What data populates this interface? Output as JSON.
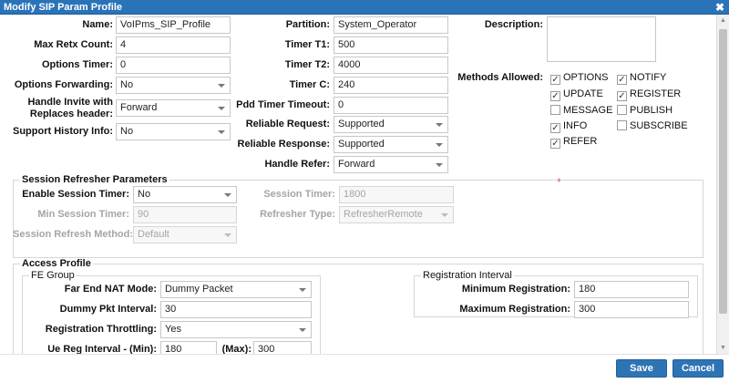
{
  "window": {
    "title": "Modify SIP Param Profile",
    "close_glyph": "✖"
  },
  "left": {
    "name_label": "Name:",
    "name_value": "VoIPms_SIP_Profile",
    "max_retx_label": "Max Retx Count:",
    "max_retx_value": "4",
    "options_timer_label": "Options Timer:",
    "options_timer_value": "0",
    "options_fwd_label": "Options Forwarding:",
    "options_fwd_value": "No",
    "handle_invite_label": "Handle Invite with Replaces header:",
    "handle_invite_value": "Forward",
    "support_history_label": "Support History Info:",
    "support_history_value": "No"
  },
  "middle": {
    "partition_label": "Partition:",
    "partition_value": "System_Operator",
    "t1_label": "Timer T1:",
    "t1_value": "500",
    "t2_label": "Timer T2:",
    "t2_value": "4000",
    "tc_label": "Timer C:",
    "tc_value": "240",
    "pdd_label": "Pdd Timer Timeout:",
    "pdd_value": "0",
    "rel_req_label": "Reliable Request:",
    "rel_req_value": "Supported",
    "rel_resp_label": "Reliable Response:",
    "rel_resp_value": "Supported",
    "handle_refer_label": "Handle Refer:",
    "handle_refer_value": "Forward"
  },
  "right": {
    "description_label": "Description:",
    "methods_label": "Methods Allowed:",
    "methods": [
      {
        "label": "OPTIONS",
        "checked": true
      },
      {
        "label": "NOTIFY",
        "checked": true
      },
      {
        "label": "UPDATE",
        "checked": true
      },
      {
        "label": "REGISTER",
        "checked": true
      },
      {
        "label": "MESSAGE",
        "checked": false
      },
      {
        "label": "PUBLISH",
        "checked": false
      },
      {
        "label": "INFO",
        "checked": true
      },
      {
        "label": "SUBSCRIBE",
        "checked": false
      },
      {
        "label": "REFER",
        "checked": true
      }
    ]
  },
  "session_refresher": {
    "legend": "Session Refresher Parameters",
    "enable_label": "Enable Session Timer:",
    "enable_value": "No",
    "session_timer_label": "Session Timer:",
    "session_timer_value": "1800",
    "min_session_label": "Min Session Timer:",
    "min_session_value": "90",
    "refresher_type_label": "Refresher Type:",
    "refresher_type_value": "RefresherRemote",
    "refresh_method_label": "Session Refresh Method:",
    "refresh_method_value": "Default"
  },
  "access_profile": {
    "legend": "Access Profile",
    "fe_group_legend": "FE Group",
    "nat_mode_label": "Far End NAT Mode:",
    "nat_mode_value": "Dummy Packet",
    "dummy_pkt_label": "Dummy Pkt Interval:",
    "dummy_pkt_value": "30",
    "reg_throttle_label": "Registration Throttling:",
    "reg_throttle_value": "Yes",
    "ue_reg_label": "Ue Reg Interval - (Min):",
    "ue_reg_min_value": "180",
    "ue_reg_max_label": "(Max):",
    "ue_reg_max_value": "300",
    "reg_interval_legend": "Registration Interval",
    "min_reg_label": "Minimum Registration:",
    "min_reg_value": "180",
    "max_reg_label": "Maximum Registration:",
    "max_reg_value": "300"
  },
  "footer": {
    "save_label": "Save",
    "cancel_label": "Cancel"
  },
  "colors": {
    "title_bar": "#2a73b8",
    "button": "#2e74b5",
    "marker": "#e03030"
  },
  "icons": {
    "close": "close-icon",
    "dropdown": "chevron-down-icon",
    "check": "checkmark-icon"
  }
}
